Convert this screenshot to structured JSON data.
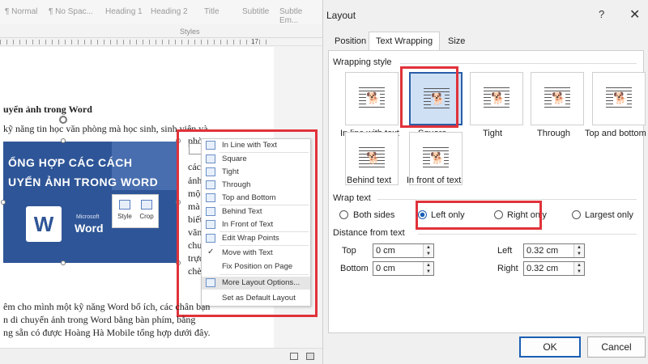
{
  "word": {
    "styles": [
      "¶ Normal",
      "¶ No Spac...",
      "Heading 1",
      "Heading 2",
      "Title",
      "Subtitle",
      "Subtle Em..."
    ],
    "styles_group_label": "Styles",
    "ruler_marker": "17",
    "doc_heading": "uyển ảnh trong Word",
    "doc_lines_top": [
      "kỹ năng tin học văn phòng mà học sinh, sinh viên và"
    ],
    "image": {
      "title_line1": "ỔNG HỢP CÁC CÁCH",
      "title_line2": "UYỂN ẢNH TRONG WORD",
      "microsoft_label": "Microsoft",
      "word_label": "Word",
      "logo_letter": "W",
      "tool_style": "Style",
      "tool_crop": "Crop"
    },
    "side_fragments": [
      "phò",
      "cách",
      "ảnh",
      "một",
      "mà",
      "biết",
      "văn",
      "chuy",
      "trực",
      "chèn"
    ],
    "doc_lines_bottom": [
      "êm cho mình một kỹ năng Word bổ ích, các chân bạn",
      "n di chuyển ảnh trong Word bằng bàn phím, bằng",
      "ng sẵn có được Hoàng Hà Mobile tổng hợp dưới đây."
    ],
    "context_menu": [
      {
        "label": "In Line with Text"
      },
      {
        "label": "Square"
      },
      {
        "label": "Tight"
      },
      {
        "label": "Through"
      },
      {
        "label": "Top and Bottom"
      },
      {
        "label": "Behind Text"
      },
      {
        "label": "In Front of Text"
      },
      {
        "label": "Edit Wrap Points"
      },
      {
        "label": "Move with Text",
        "checked": true
      },
      {
        "label": "Fix Position on Page"
      },
      {
        "label": "More Layout Options...",
        "selected": true
      },
      {
        "label": "Set as Default Layout"
      }
    ],
    "check_glyph": "✓"
  },
  "dialog": {
    "title": "Layout",
    "help": "?",
    "close": "✕",
    "tabs": [
      "Position",
      "Text Wrapping",
      "Size"
    ],
    "active_tab": "Text Wrapping",
    "wrapping_style_label": "Wrapping style",
    "wrap_styles": [
      "In line with text",
      "Square",
      "Tight",
      "Through",
      "Top and bottom",
      "Behind text",
      "In front of text"
    ],
    "selected_wrap_style": "Square",
    "wrap_text_label": "Wrap text",
    "wrap_text_options": [
      "Both sides",
      "Left only",
      "Right only",
      "Largest only"
    ],
    "selected_wrap_text": "Left only",
    "distance_label": "Distance from text",
    "distance": {
      "top_label": "Top",
      "top_value": "0 cm",
      "bottom_label": "Bottom",
      "bottom_value": "0 cm",
      "left_label": "Left",
      "left_value": "0.32 cm",
      "right_label": "Right",
      "right_value": "0.32 cm"
    },
    "ok": "OK",
    "cancel": "Cancel",
    "highlight_color": "#e0323a",
    "accent_color": "#1a5fb4"
  }
}
